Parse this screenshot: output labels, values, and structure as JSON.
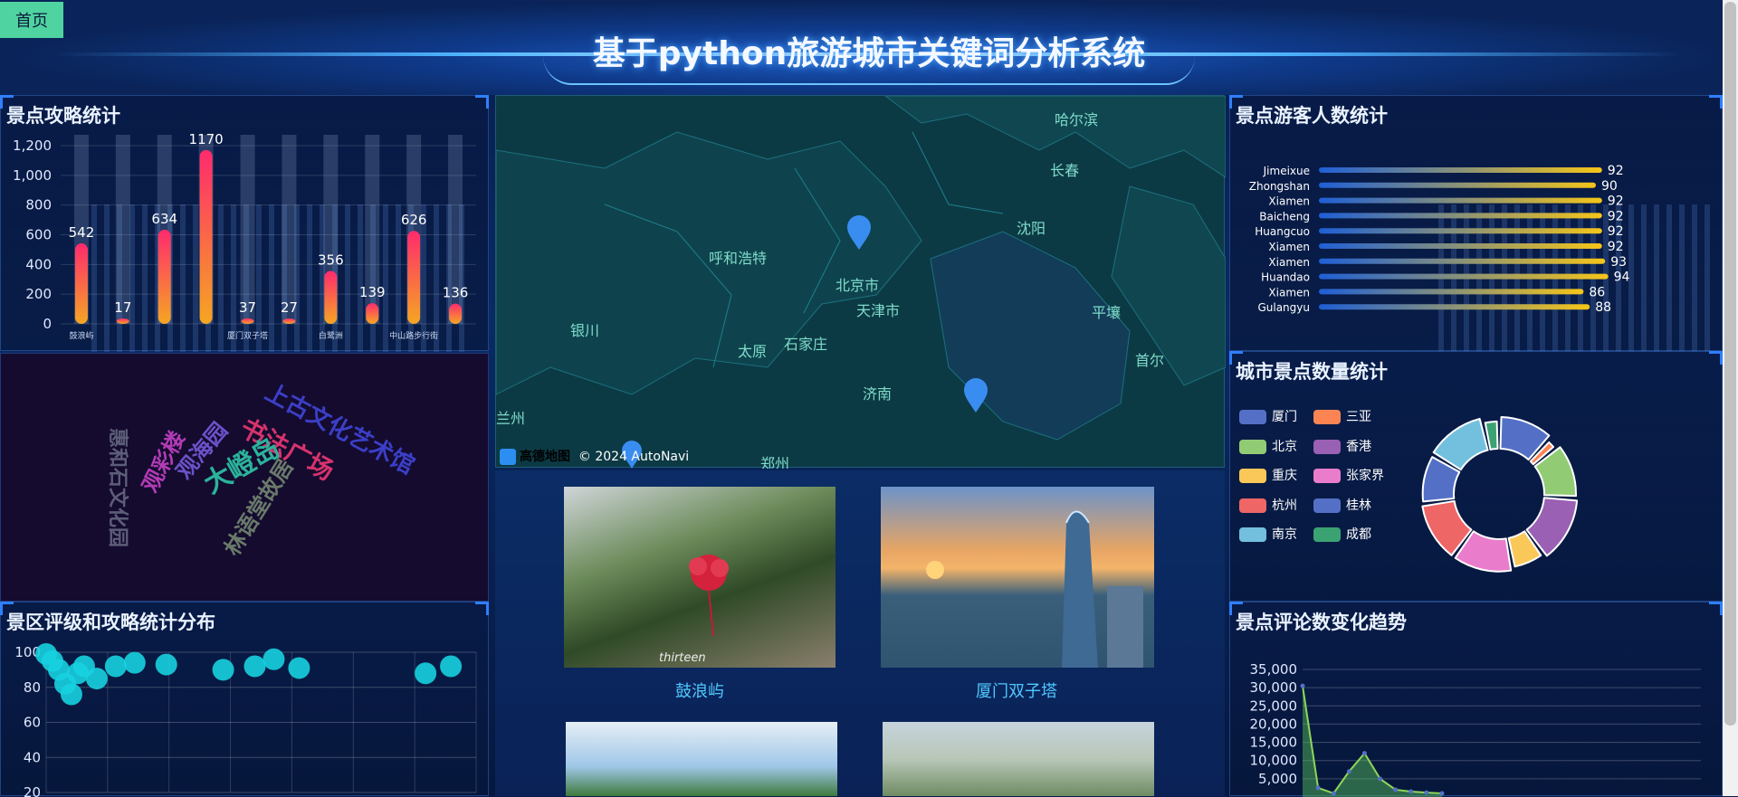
{
  "header": {
    "title": "基于python旅游城市关键词分析系统",
    "home_label": "首页"
  },
  "colors": {
    "accent": "#4fd3a0",
    "title_glow": "#4aa3ff",
    "cyan": "#17d2e0",
    "gold": "#f5c518"
  },
  "strategy_panel": {
    "title": "景点攻略统计",
    "chart_data": {
      "type": "bar",
      "title": "",
      "ylim": [
        0,
        1200
      ],
      "yticks": [
        "0",
        "200",
        "400",
        "600",
        "800",
        "1,000",
        "1,200"
      ],
      "categories": [
        "鼓浪屿",
        "",
        "",
        "",
        "",
        "",
        "",
        "",
        "",
        "",
        "",
        ""
      ],
      "values": [
        542,
        17,
        634,
        1170,
        37,
        27,
        356,
        139,
        626,
        136
      ],
      "value_labels": [
        "542",
        "17",
        "634",
        "1170",
        "37",
        "27",
        "356",
        "139",
        "626",
        "136"
      ],
      "x_tick_labels": [
        "鼓浪屿",
        "",
        "",
        "",
        "厦门双子塔",
        "",
        "白鹭洲",
        "",
        "中山路步行街",
        ""
      ]
    }
  },
  "cloud_panel": {
    "words": [
      {
        "text": "上古文化艺术馆",
        "color": "#3b3fc6"
      },
      {
        "text": "书法广场",
        "color": "#d6336c"
      },
      {
        "text": "大嶝岛",
        "color": "#2bb39b"
      },
      {
        "text": "观海园",
        "color": "#6b52c9"
      },
      {
        "text": "观彩楼",
        "color": "#b23bb5"
      },
      {
        "text": "林语堂故居",
        "color": "#6a7a6a"
      },
      {
        "text": "惠和石文化园",
        "color": "#5d5d78"
      }
    ]
  },
  "scatter_panel": {
    "title": "景区评级和攻略统计分布",
    "chart_data": {
      "type": "scatter",
      "ylim": [
        20,
        100
      ],
      "yticks": [
        "20",
        "40",
        "60",
        "80",
        "100"
      ],
      "points": [
        [
          0,
          99
        ],
        [
          5,
          95
        ],
        [
          10,
          90
        ],
        [
          15,
          82
        ],
        [
          20,
          76
        ],
        [
          25,
          88
        ],
        [
          30,
          92
        ],
        [
          40,
          85
        ],
        [
          55,
          92
        ],
        [
          70,
          94
        ],
        [
          95,
          93
        ],
        [
          140,
          90
        ],
        [
          165,
          92
        ],
        [
          180,
          96
        ],
        [
          200,
          91
        ],
        [
          300,
          88
        ],
        [
          320,
          92
        ]
      ]
    }
  },
  "map_panel": {
    "cities": [
      "哈尔滨",
      "长春",
      "沈阳",
      "呼和浩特",
      "北京市",
      "天津市",
      "银川",
      "太原",
      "石家庄",
      "平壤",
      "首尔",
      "济南",
      "郑州",
      "兰州"
    ],
    "watermark": "高德地图",
    "copyright": "© 2024 AutoNavi"
  },
  "pictures": [
    {
      "caption": "鼓浪屿",
      "signature": "thirteen"
    },
    {
      "caption": "厦门双子塔"
    },
    {
      "caption": ""
    },
    {
      "caption": ""
    }
  ],
  "visitors_panel": {
    "title": "景点游客人数统计",
    "chart_data": {
      "type": "bar",
      "orientation": "horizontal",
      "xlim": [
        0,
        100
      ],
      "categories": [
        "Jimeixue",
        "Zhongshan",
        "Xiamen",
        "Baicheng",
        "Huangcuo",
        "Xiamen",
        "Xiamen",
        "Huandao",
        "Xiamen",
        "Gulangyu"
      ],
      "values": [
        92,
        90,
        92,
        92,
        92,
        92,
        93,
        94,
        86,
        88
      ]
    }
  },
  "city_panel": {
    "title": "城市景点数量统计",
    "chart_data": {
      "type": "pie",
      "style": "rose-ring",
      "legend": [
        {
          "name": "厦门",
          "color": "#5470c6"
        },
        {
          "name": "三亚",
          "color": "#fc8452"
        },
        {
          "name": "北京",
          "color": "#91cc75"
        },
        {
          "name": "香港",
          "color": "#9a60b4"
        },
        {
          "name": "重庆",
          "color": "#fac858"
        },
        {
          "name": "张家界",
          "color": "#ea7ccc"
        },
        {
          "name": "杭州",
          "color": "#ee6666"
        },
        {
          "name": "桂林",
          "color": "#5470c6"
        },
        {
          "name": "南京",
          "color": "#73c0de"
        },
        {
          "name": "成都",
          "color": "#3ba272"
        }
      ],
      "values": [
        20,
        4,
        20,
        24,
        12,
        22,
        22,
        18,
        22,
        6
      ]
    }
  },
  "comments_panel": {
    "title": "景点评论数变化趋势",
    "chart_data": {
      "type": "area",
      "ylim": [
        0,
        35000
      ],
      "yticks": [
        "5,000",
        "10,000",
        "15,000",
        "20,000",
        "25,000",
        "30,000",
        "35,000"
      ],
      "x": [
        0,
        1,
        2,
        3,
        4,
        5,
        6,
        7,
        8,
        9
      ],
      "values": [
        30500,
        2500,
        1000,
        7000,
        12000,
        5000,
        2000,
        1500,
        1200,
        1000
      ]
    }
  }
}
